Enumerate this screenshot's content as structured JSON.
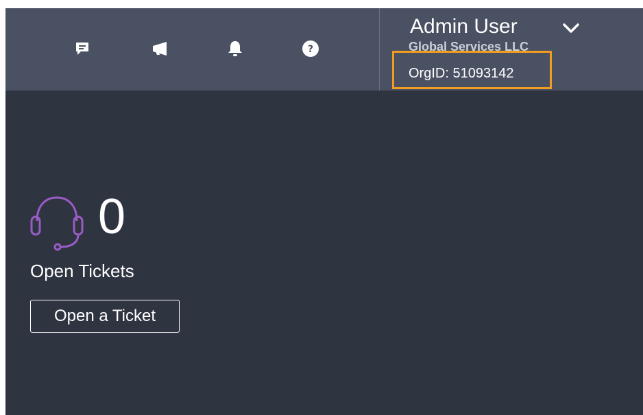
{
  "header": {
    "icons": [
      "feedback-icon",
      "megaphone-icon",
      "bell-icon",
      "help-icon"
    ],
    "user": {
      "name": "Admin User",
      "org_name": "Global Services LLC",
      "org_id": "OrgID: 51093142"
    }
  },
  "tickets": {
    "count": "0",
    "label": "Open Tickets",
    "button_label": "Open a Ticket"
  },
  "colors": {
    "topbar": "#4a5163",
    "background": "#2f3441",
    "highlight": "#f39c1f",
    "headset_accent": "#9a5cc6"
  }
}
